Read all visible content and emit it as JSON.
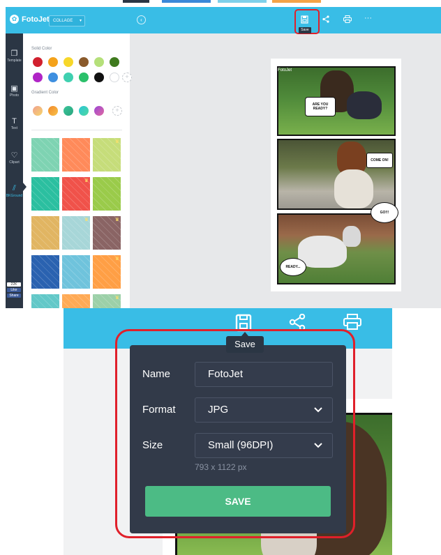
{
  "colors": {
    "accent": "#39bde6",
    "dark_sidebar": "#2b3644",
    "dialog_bg": "#323a49",
    "save_green": "#4cbb85",
    "highlight_red": "#e0202a"
  },
  "app": {
    "logo": "FotoJet",
    "mode_select": "COLLAGE",
    "sidebar": [
      {
        "label": "Template",
        "icon": "template-icon"
      },
      {
        "label": "Photo",
        "icon": "photo-icon"
      },
      {
        "label": "Text",
        "icon": "text-icon"
      },
      {
        "label": "Clipart",
        "icon": "heart-icon"
      },
      {
        "label": "BKGround",
        "icon": "background-icon"
      }
    ],
    "social": {
      "count": "22K",
      "like": "Like",
      "share": "Share"
    },
    "panel": {
      "solid_label": "Solid Color",
      "gradient_label": "Gradient Color",
      "solid_colors": [
        "#d1202e",
        "#f4a21b",
        "#f7d72a",
        "#8a5a2b",
        "#b5e07a",
        "#3f7a1e",
        "#b025c6",
        "#3e8fe0",
        "#3fd0b0",
        "#2bc06a",
        "#111111",
        "#ffffff"
      ],
      "gradient_colors": [
        [
          "#f0a090",
          "#f6d56a"
        ],
        [
          "#f2882a",
          "#f7c24a"
        ],
        [
          "#3bc49a",
          "#2aa57e"
        ],
        [
          "#2bc6d6",
          "#4fd8a0"
        ],
        [
          "#9b45d6",
          "#e06aa0"
        ]
      ],
      "tiles": [
        {
          "color": "#7ed3b2",
          "premium": false
        },
        {
          "color": "#ff8a5a",
          "premium": false
        },
        {
          "color": "#c6dd7a",
          "premium": true
        },
        {
          "color": "#2bbfa0",
          "premium": false
        },
        {
          "color": "#f0524a",
          "premium": true
        },
        {
          "color": "#9acb4a",
          "premium": false
        },
        {
          "color": "#e1b562",
          "premium": false
        },
        {
          "color": "#a7d6d8",
          "premium": true
        },
        {
          "color": "#8a6464",
          "premium": true
        },
        {
          "color": "#2a62b0",
          "premium": false
        },
        {
          "color": "#6fc3dc",
          "premium": false
        },
        {
          "color": "#ff9f45",
          "premium": true
        },
        {
          "color": "#62c8c8",
          "premium": false
        },
        {
          "color": "#ffaa55",
          "premium": false
        },
        {
          "color": "#9cd0a8",
          "premium": true
        }
      ]
    },
    "toolbar": {
      "save_tooltip": "Save"
    },
    "comic": {
      "title": "FotoJet",
      "bubbles": [
        "ARE YOU READY?",
        "COME ON!",
        "GO!!!",
        "READY..."
      ]
    }
  },
  "zoom": {
    "save_tooltip": "Save",
    "dialog": {
      "name_label": "Name",
      "name_value": "FotoJet",
      "format_label": "Format",
      "format_value": "JPG",
      "size_label": "Size",
      "size_value": "Small (96DPI)",
      "dimensions": "793 x 1122 px",
      "save_button": "SAVE"
    }
  }
}
